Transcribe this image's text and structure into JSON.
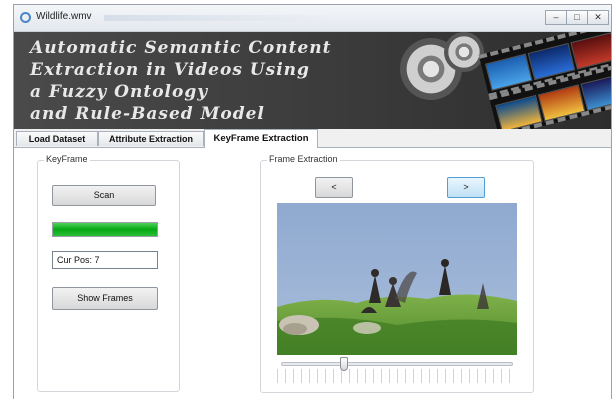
{
  "window": {
    "title": "Wildlife.wmv",
    "controls": {
      "minimize": "‒",
      "maximize": "□",
      "close": "✕"
    }
  },
  "banner": {
    "lines": [
      "Automatic Semantic Content",
      "Extraction in Videos Using",
      "a Fuzzy Ontology",
      "and Rule-Based Model"
    ]
  },
  "tabs": [
    {
      "label": "Load Dataset",
      "active": false
    },
    {
      "label": "Attribute Extraction",
      "active": false
    },
    {
      "label": "KeyFrame Extraction",
      "active": true
    }
  ],
  "keyframe_group": {
    "title": "KeyFrame",
    "scan_label": "Scan",
    "progress_fraction": 1.0,
    "cur_pos_value": "Cur Pos: 7",
    "show_frames_label": "Show Frames"
  },
  "frame_extraction_group": {
    "title": "Frame Extraction",
    "prev_label": "<",
    "next_label": ">",
    "slider_fraction": 0.27
  },
  "colors": {
    "progress": "#06a915",
    "banner": "#3b3b3b",
    "next_button_accent": "#4f9fd0"
  }
}
